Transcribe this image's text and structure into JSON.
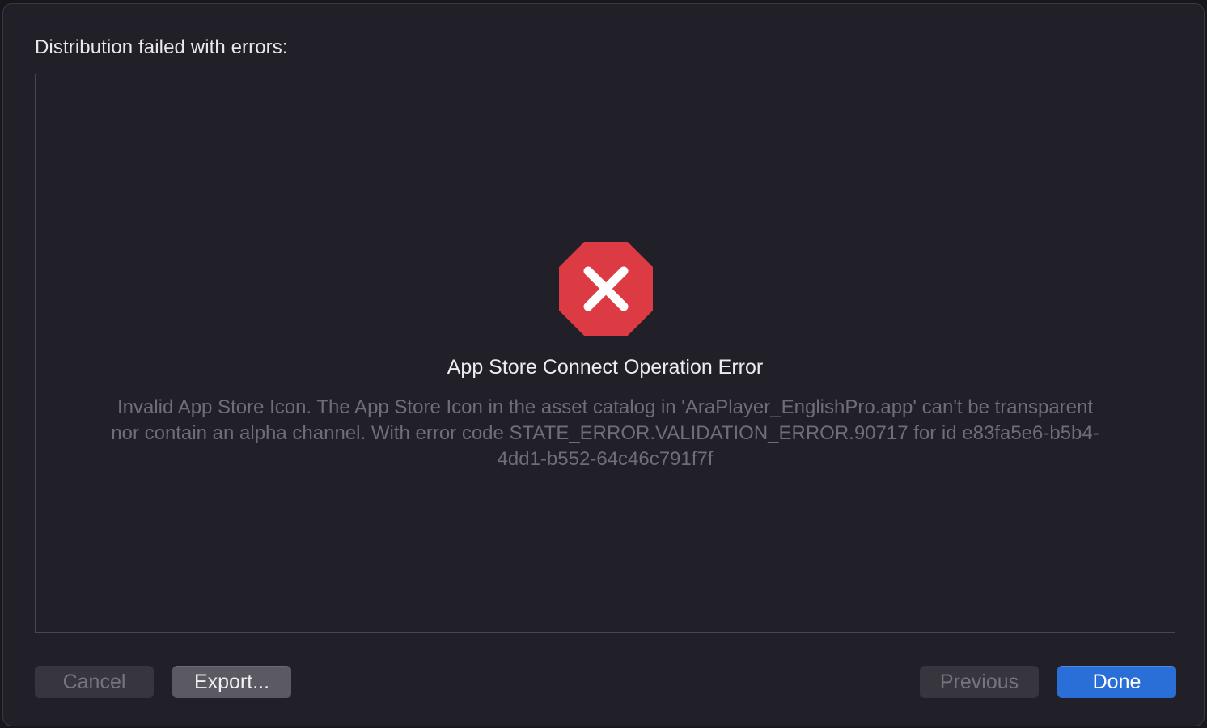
{
  "dialog": {
    "header": "Distribution failed with errors:",
    "error": {
      "icon": "error-octagon-x-icon",
      "icon_color": "#dd3b43",
      "title": "App Store Connect Operation Error",
      "message": "Invalid App Store Icon. The App Store Icon in the asset catalog in 'AraPlayer_EnglishPro.app' can't be transparent nor contain an alpha channel. With error code STATE_ERROR.VALIDATION_ERROR.90717 for id e83fa5e6-b5b4-4dd1-b552-64c46c791f7f"
    },
    "buttons": {
      "cancel": "Cancel",
      "export": "Export...",
      "previous": "Previous",
      "done": "Done"
    },
    "accent_color": "#2a6fd8"
  }
}
